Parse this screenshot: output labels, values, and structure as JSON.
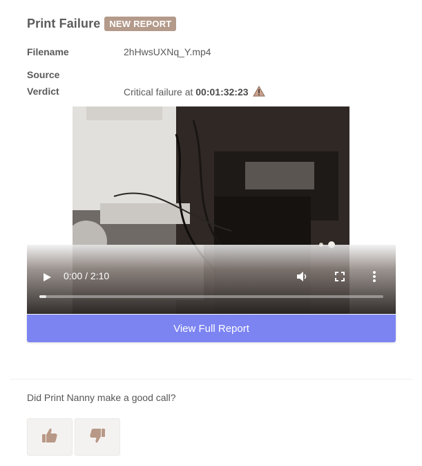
{
  "header": {
    "title": "Print Failure",
    "badge": "NEW REPORT"
  },
  "details": {
    "filename_label": "Filename",
    "filename_value": "2hHwsUXNq_Y.mp4",
    "source_label": "Source",
    "source_value": "",
    "verdict_label": "Verdict",
    "verdict_prefix": "Critical failure at",
    "verdict_time": "00:01:32:23",
    "verdict_icon": "warning-icon"
  },
  "video": {
    "time_display": "0:00 / 2:10",
    "progress": 0,
    "controls": [
      "play-icon",
      "volume-icon",
      "fullscreen-icon",
      "more-options-icon"
    ]
  },
  "actions": {
    "view_report_label": "View Full Report"
  },
  "feedback": {
    "question": "Did Print Nanny make a good call?",
    "thumbs_up_icon": "thumbs-up-icon",
    "thumbs_down_icon": "thumbs-down-icon"
  },
  "colors": {
    "badge": "#b49a8a",
    "button": "#7c84f2",
    "vote_icon": "#b89886"
  }
}
